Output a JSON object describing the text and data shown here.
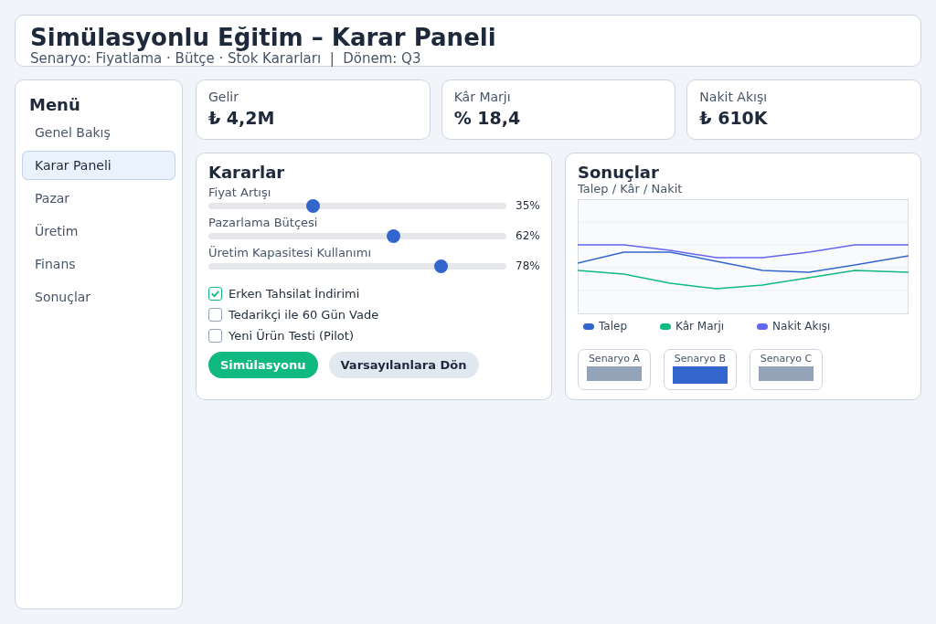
{
  "header": {
    "title": "Simülasyonlu Eğitim – Karar Paneli",
    "subtitle": "Senaryo: Fiyatlama · Bütçe · Stok Kararları  |  Dönem: Q3"
  },
  "sidebar": {
    "title": "Menü",
    "items": [
      {
        "label": "Genel Bakış",
        "selected": false
      },
      {
        "label": "Karar Paneli",
        "selected": true
      },
      {
        "label": "Pazar",
        "selected": false
      },
      {
        "label": "Üretim",
        "selected": false
      },
      {
        "label": "Finans",
        "selected": false
      },
      {
        "label": "Sonuçlar",
        "selected": false
      }
    ]
  },
  "kpis": [
    {
      "label": "Gelir",
      "value": "₺ 4,2M"
    },
    {
      "label": "Kâr Marjı",
      "value": "% 18,4"
    },
    {
      "label": "Nakit Akışı",
      "value": "₺ 610K"
    }
  ],
  "decisions": {
    "title": "Kararlar",
    "sliders": [
      {
        "label": "Fiyat Artışı",
        "level": 0.35,
        "reading": "35%"
      },
      {
        "label": "Pazarlama Bütçesi",
        "level": 0.62,
        "reading": "62%"
      },
      {
        "label": "Üretim Kapasitesi Kullanımı",
        "level": 0.78,
        "reading": "78%"
      }
    ],
    "options": [
      {
        "label": "Erken Tahsilat İndirimi",
        "checked": true
      },
      {
        "label": "Tedarikçi ile 60 Gün Vade",
        "checked": false
      },
      {
        "label": "Yeni Ürün Testi (Pilot)",
        "checked": false
      }
    ],
    "buttons": [
      {
        "label": "Simülasyonu",
        "kind": "primary"
      },
      {
        "label": "Varsayılanlara Dön",
        "kind": "secondary"
      }
    ]
  },
  "results": {
    "title": "Sonuçlar",
    "subtitle": "Talep / Kâr / Nakit",
    "legend": [
      {
        "label": "Talep",
        "color": "#3366cc"
      },
      {
        "label": "Kâr Marjı",
        "color": "#10b981"
      },
      {
        "label": "Nakit Akışı",
        "color": "#6366f1"
      }
    ],
    "scenarios": [
      {
        "label": "Senaryo A",
        "selected": false
      },
      {
        "label": "Senaryo B",
        "selected": true
      },
      {
        "label": "Senaryo C",
        "selected": false
      }
    ]
  }
}
